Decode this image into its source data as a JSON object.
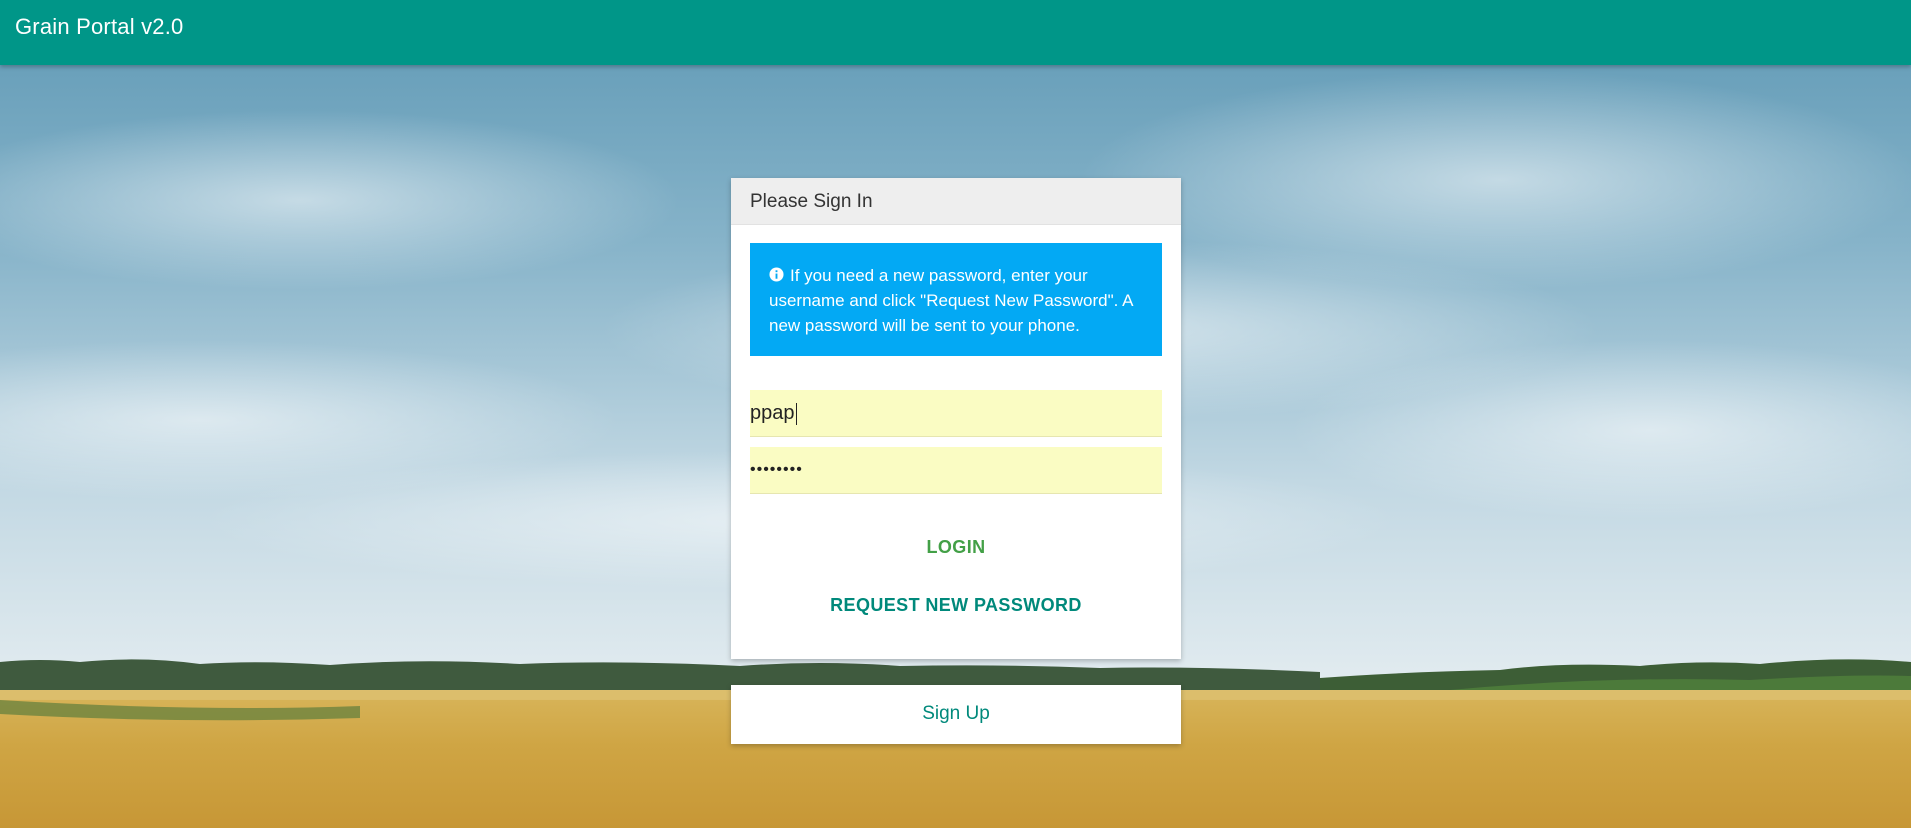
{
  "app": {
    "title": "Grain Portal v2.0"
  },
  "colors": {
    "topbar": "#009688",
    "info_box": "#03a9f4",
    "login": "#43a047",
    "request": "#00897b",
    "field_bg": "#fafcc3"
  },
  "login_card": {
    "header": "Please Sign In",
    "info_icon": "info-circle-icon",
    "info_text": "If you need a new password, enter your username and click \"Request New Password\". A new password will be sent to your phone.",
    "username_value": "ppap",
    "password_value": "••••••••",
    "login_label": "LOGIN",
    "request_label": "REQUEST NEW PASSWORD"
  },
  "signup": {
    "label": "Sign Up"
  }
}
